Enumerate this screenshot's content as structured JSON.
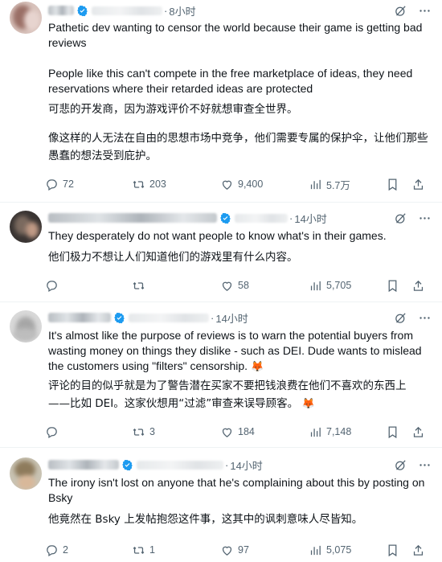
{
  "colors": {
    "verified": "#1d9bf0",
    "text": "#0f1419",
    "muted": "#536471",
    "divider": "#eff3f4"
  },
  "posts": [
    {
      "time": "8小时",
      "text_en_1": "Pathetic dev wanting to censor the world because their game is getting bad reviews",
      "text_en_2": "People like this can't compete in the free marketplace of ideas, they need reservations where their retarded ideas are protected",
      "text_zh_1": "可悲的开发商，因为游戏评价不好就想审查全世界。",
      "text_zh_2": "像这样的人无法在自由的思想市场中竞争，他们需要专属的保护伞，让他们那些愚蠢的想法受到庇护。",
      "replies": "72",
      "reposts": "203",
      "likes": "9,400",
      "views": "5.7万"
    },
    {
      "time": "14小时",
      "text_en": "They desperately do not want people to know what's in their games.",
      "text_zh": "他们极力不想让人们知道他们的游戏里有什么内容。",
      "replies": "",
      "reposts": "",
      "likes": "58",
      "views": "5,705"
    },
    {
      "time": "14小时",
      "text_en": "It's almost like the purpose of reviews is to warn the potential buyers from wasting money on things they dislike - such as DEI. Dude wants to mislead the customers using \"filters\" censorship.",
      "text_zh_1": "评论的目的似乎就是为了警告潜在买家不要把钱浪费在他们不喜欢的东西上",
      "text_zh_2": "——比如 DEI。这家伙想用“过滤”审查来误导顾客。",
      "emoji": "🦊",
      "replies": "",
      "reposts": "3",
      "likes": "184",
      "views": "7,148"
    },
    {
      "time": "14小时",
      "text_en": "The irony isn't lost on anyone that he's complaining about this by posting on Bsky",
      "text_zh": "他竟然在 Bsky 上发帖抱怨这件事，这其中的讽刺意味人尽皆知。",
      "replies": "2",
      "reposts": "1",
      "likes": "97",
      "views": "5,075"
    }
  ]
}
